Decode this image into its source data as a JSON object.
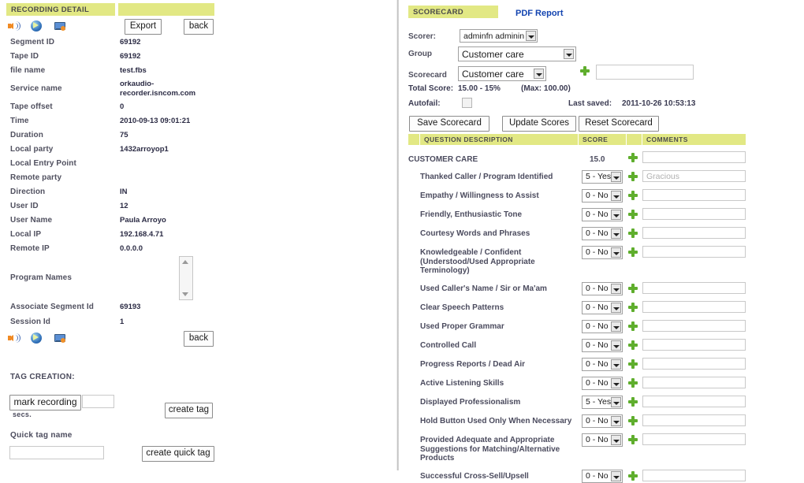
{
  "left": {
    "header_title": "RECORDING DETAIL",
    "toolbar": {
      "icons": [
        "audio-speaker-icon",
        "media-play-icon",
        "screen-capture-icon"
      ],
      "export_label": "Export",
      "back_label": "back"
    },
    "details": [
      {
        "label": "Segment ID",
        "value": "69192"
      },
      {
        "label": "Tape ID",
        "value": "69192"
      },
      {
        "label": "file name",
        "value": "test.fbs"
      },
      {
        "label": "Service name",
        "value": "orkaudio-\nrecorder.isncom.com"
      },
      {
        "label": "Tape offset",
        "value": "0"
      },
      {
        "label": "Time",
        "value": "2010-09-13 09:01:21"
      },
      {
        "label": "Duration",
        "value": "75"
      },
      {
        "label": "Local party",
        "value": "1432arroyop1"
      },
      {
        "label": "Local Entry Point",
        "value": ""
      },
      {
        "label": "Remote party",
        "value": ""
      },
      {
        "label": "Direction",
        "value": "IN"
      },
      {
        "label": "User ID",
        "value": "12"
      },
      {
        "label": "User Name",
        "value": "Paula Arroyo"
      },
      {
        "label": "Local IP",
        "value": "192.168.4.71"
      },
      {
        "label": "Remote IP",
        "value": "0.0.0.0"
      },
      {
        "label": "Program Names",
        "value": ""
      },
      {
        "label": "Associate Segment Id",
        "value": "69193"
      },
      {
        "label": "Session Id",
        "value": "1"
      }
    ],
    "bottom_back_label": "back",
    "tag_creation": {
      "title": "TAG CREATION:",
      "mark_recording_label": "mark recording",
      "secs_value": "",
      "secs_label": "secs.",
      "create_tag_label": "create tag",
      "quick_tag_name_label": "Quick tag name",
      "quick_tag_value": "",
      "create_quick_tag_label": "create quick tag"
    }
  },
  "right": {
    "header_title": "SCORECARD",
    "pdf_report_label": "PDF Report",
    "form": {
      "scorer_label": "Scorer:",
      "scorer_value": "adminfn adminin",
      "group_label": "Group",
      "group_value": "Customer care",
      "scorecard_label": "Scorecard",
      "scorecard_value": "Customer care",
      "new_scorecard_value": "",
      "total_score_label": "Total Score:",
      "total_score_value": "15.00 - 15%",
      "max_label": "(Max: 100.00)",
      "autofail_label": "Autofail:",
      "last_saved_label": "Last saved:",
      "last_saved_value": "2011-10-26 10:53:13"
    },
    "buttons": {
      "save_label": "Save Scorecard",
      "update_label": "Update Scores",
      "reset_label": "Reset Scorecard"
    },
    "table": {
      "columns": [
        "QUESTION DESCRIPTION",
        "SCORE",
        "COMMENTS"
      ],
      "rows": [
        {
          "label": "CUSTOMER CARE",
          "indent": 0,
          "score_text": "15.0",
          "is_section": true,
          "comment": ""
        },
        {
          "label": "Thanked Caller / Program Identified",
          "indent": 1,
          "score": "5 - Yes",
          "comment": "Gracious"
        },
        {
          "label": "Empathy / Willingness to Assist",
          "indent": 1,
          "score": "0 - No",
          "comment": ""
        },
        {
          "label": "Friendly, Enthusiastic Tone",
          "indent": 1,
          "score": "0 - No",
          "comment": ""
        },
        {
          "label": "Courtesy Words and Phrases",
          "indent": 1,
          "score": "0 - No",
          "comment": ""
        },
        {
          "label": "Knowledgeable / Confident\n(Understood/Used Appropriate\nTerminology)",
          "indent": 1,
          "score": "0 - No",
          "comment": ""
        },
        {
          "label": "Used Caller's Name / Sir or Ma'am",
          "indent": 1,
          "score": "0 - No",
          "comment": ""
        },
        {
          "label": "Clear Speech Patterns",
          "indent": 1,
          "score": "0 - No",
          "comment": ""
        },
        {
          "label": "Used Proper Grammar",
          "indent": 1,
          "score": "0 - No",
          "comment": ""
        },
        {
          "label": "Controlled Call",
          "indent": 1,
          "score": "0 - No",
          "comment": ""
        },
        {
          "label": "Progress Reports / Dead Air",
          "indent": 1,
          "score": "0 - No",
          "comment": ""
        },
        {
          "label": "Active Listening Skills",
          "indent": 1,
          "score": "0 - No",
          "comment": ""
        },
        {
          "label": "Displayed Professionalism",
          "indent": 1,
          "score": "5 - Yes",
          "comment": ""
        },
        {
          "label": "Hold Button Used Only When Necessary",
          "indent": 1,
          "score": "0 - No",
          "comment": ""
        },
        {
          "label": "Provided Adequate and Appropriate\nSuggestions for Matching/Alternative\nProducts",
          "indent": 1,
          "score": "0 - No",
          "comment": ""
        },
        {
          "label": "Successful Cross-Sell/Upsell",
          "indent": 1,
          "score": "0 - No",
          "comment": ""
        }
      ]
    }
  },
  "colors": {
    "highlight": "#e2e884",
    "link": "#1344b0",
    "plus_green": "#5fae2d"
  }
}
